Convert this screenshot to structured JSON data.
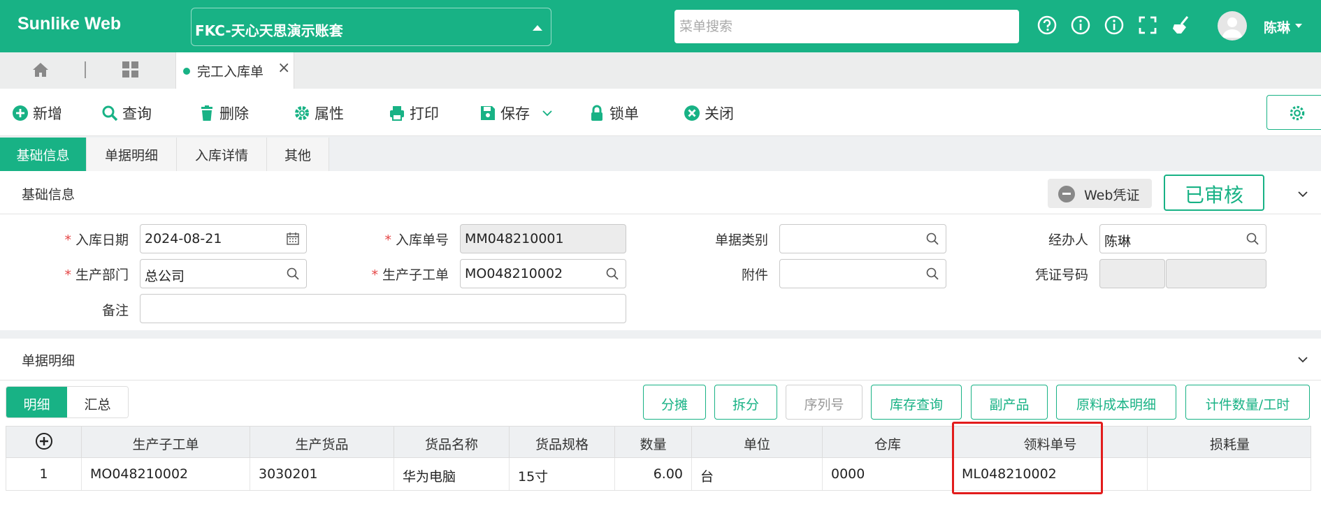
{
  "header": {
    "brand": "Sunlike Web",
    "account": "FKC-天心天思演示账套",
    "search_placeholder": "菜单搜索",
    "user": "陈琳"
  },
  "tabs": {
    "page_tab": "完工入库单"
  },
  "toolbar": {
    "new": "新增",
    "query": "查询",
    "delete": "删除",
    "properties": "属性",
    "print": "打印",
    "save": "保存",
    "lock": "锁单",
    "close": "关闭"
  },
  "section_tabs": [
    "基础信息",
    "单据明细",
    "入库详情",
    "其他"
  ],
  "basic": {
    "title": "基础信息",
    "web_voucher": "Web凭证",
    "status": "已审核",
    "fields": {
      "date_label": "入库日期",
      "date_value": "2024-08-21",
      "doc_no_label": "入库单号",
      "doc_no_value": "MM048210001",
      "category_label": "单据类别",
      "category_value": "",
      "handler_label": "经办人",
      "handler_value": "陈琳",
      "dept_label": "生产部门",
      "dept_value": "总公司",
      "work_order_label": "生产子工单",
      "work_order_value": "MO048210002",
      "attachment_label": "附件",
      "attachment_value": "",
      "voucher_label": "凭证号码",
      "remark_label": "备注",
      "remark_value": ""
    }
  },
  "detail": {
    "title": "单据明细",
    "view_tabs": [
      "明细",
      "汇总"
    ],
    "actions": [
      "分摊",
      "拆分",
      "序列号",
      "库存查询",
      "副产品",
      "原料成本明细",
      "计件数量/工时"
    ],
    "columns": [
      "生产子工单",
      "生产货品",
      "货品名称",
      "货品规格",
      "数量",
      "单位",
      "仓库",
      "领料单号",
      "损耗量"
    ],
    "rows": [
      {
        "index": "1",
        "work_order": "MO048210002",
        "product": "3030201",
        "name": "华为电脑",
        "spec": "15寸",
        "qty": "6.00",
        "unit": "台",
        "warehouse": "0000",
        "pick_no": "ML048210002",
        "loss": ""
      }
    ]
  },
  "colors": {
    "brand": "#18b285",
    "highlight": "#e21c1c"
  }
}
